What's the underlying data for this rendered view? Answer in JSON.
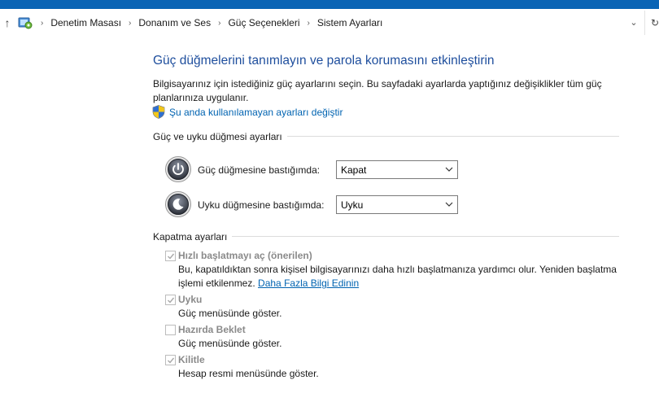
{
  "address_bar": {
    "breadcrumbs": [
      "Denetim Masası",
      "Donanım ve Ses",
      "Güç Seçenekleri",
      "Sistem Ayarları"
    ],
    "separator": "›",
    "up_glyph": "↑",
    "dropdown_glyph": "⌄",
    "refresh_glyph": "↻"
  },
  "page": {
    "title": "Güç düğmelerini tanımlayın ve parola korumasını etkinleştirin",
    "description_line1": "Bilgisayarınız için istediğiniz güç ayarlarını seçin. Bu sayfadaki ayarlarda yaptığınız değişiklikler tüm güç",
    "description_line2": "planlarınıza uygulanır.",
    "change_link": "Şu anda kullanılamayan ayarları değiştir"
  },
  "power_section": {
    "header": "Güç ve uyku düğmesi ayarları",
    "power_button_label": "Güç düğmesine bastığımda:",
    "power_button_value": "Kapat",
    "sleep_button_label": "Uyku düğmesine bastığımda:",
    "sleep_button_value": "Uyku"
  },
  "shutdown_section": {
    "header": "Kapatma ayarları",
    "items": [
      {
        "label": "Hızlı başlatmayı aç (önerilen)",
        "checked": true,
        "desc_line1": "Bu, kapatıldıktan sonra kişisel bilgisayarınızı daha hızlı başlatmanıza yardımcı olur. Yeniden başlatma",
        "desc_line2_prefix": "işlemi etkilenmez.",
        "desc_link": "Daha Fazla Bilgi Edinin"
      },
      {
        "label": "Uyku",
        "checked": true,
        "desc": "Güç menüsünde göster."
      },
      {
        "label": "Hazırda Beklet",
        "checked": false,
        "desc": "Güç menüsünde göster."
      },
      {
        "label": "Kilitle",
        "checked": true,
        "desc": "Hesap resmi menüsünde göster."
      }
    ]
  },
  "colors": {
    "title_blue": "#1e4e9d",
    "link_blue": "#0063b1",
    "titlebar_blue": "#0a64b5",
    "disabled_gray": "#8a8a8a"
  },
  "icons": [
    "control-panel-icon",
    "uac-shield-icon",
    "power-button-icon",
    "sleep-button-icon",
    "checkmark-icon",
    "chevron-down-icon"
  ]
}
